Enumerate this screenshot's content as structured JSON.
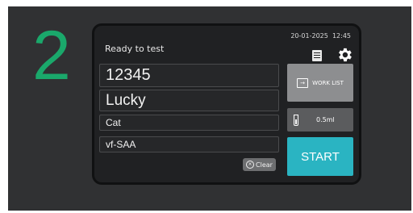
{
  "panel": {
    "step_number": "2"
  },
  "header": {
    "status": "Ready to test",
    "date": "20-01-2025",
    "time": "12:45",
    "icons": [
      "log-icon",
      "settings-icon"
    ]
  },
  "fields": {
    "sample_id": "12345",
    "patient_name": "Lucky",
    "species": "Cat",
    "test": "vf-SAA"
  },
  "buttons": {
    "clear_label": "Clear",
    "worklist_label": "WORK LIST",
    "volume_label": "0.5ml",
    "start_label": "START"
  },
  "colors": {
    "step_number": "#1aa86b",
    "start_button": "#2ab4c2",
    "screen_bg": "#202123"
  }
}
